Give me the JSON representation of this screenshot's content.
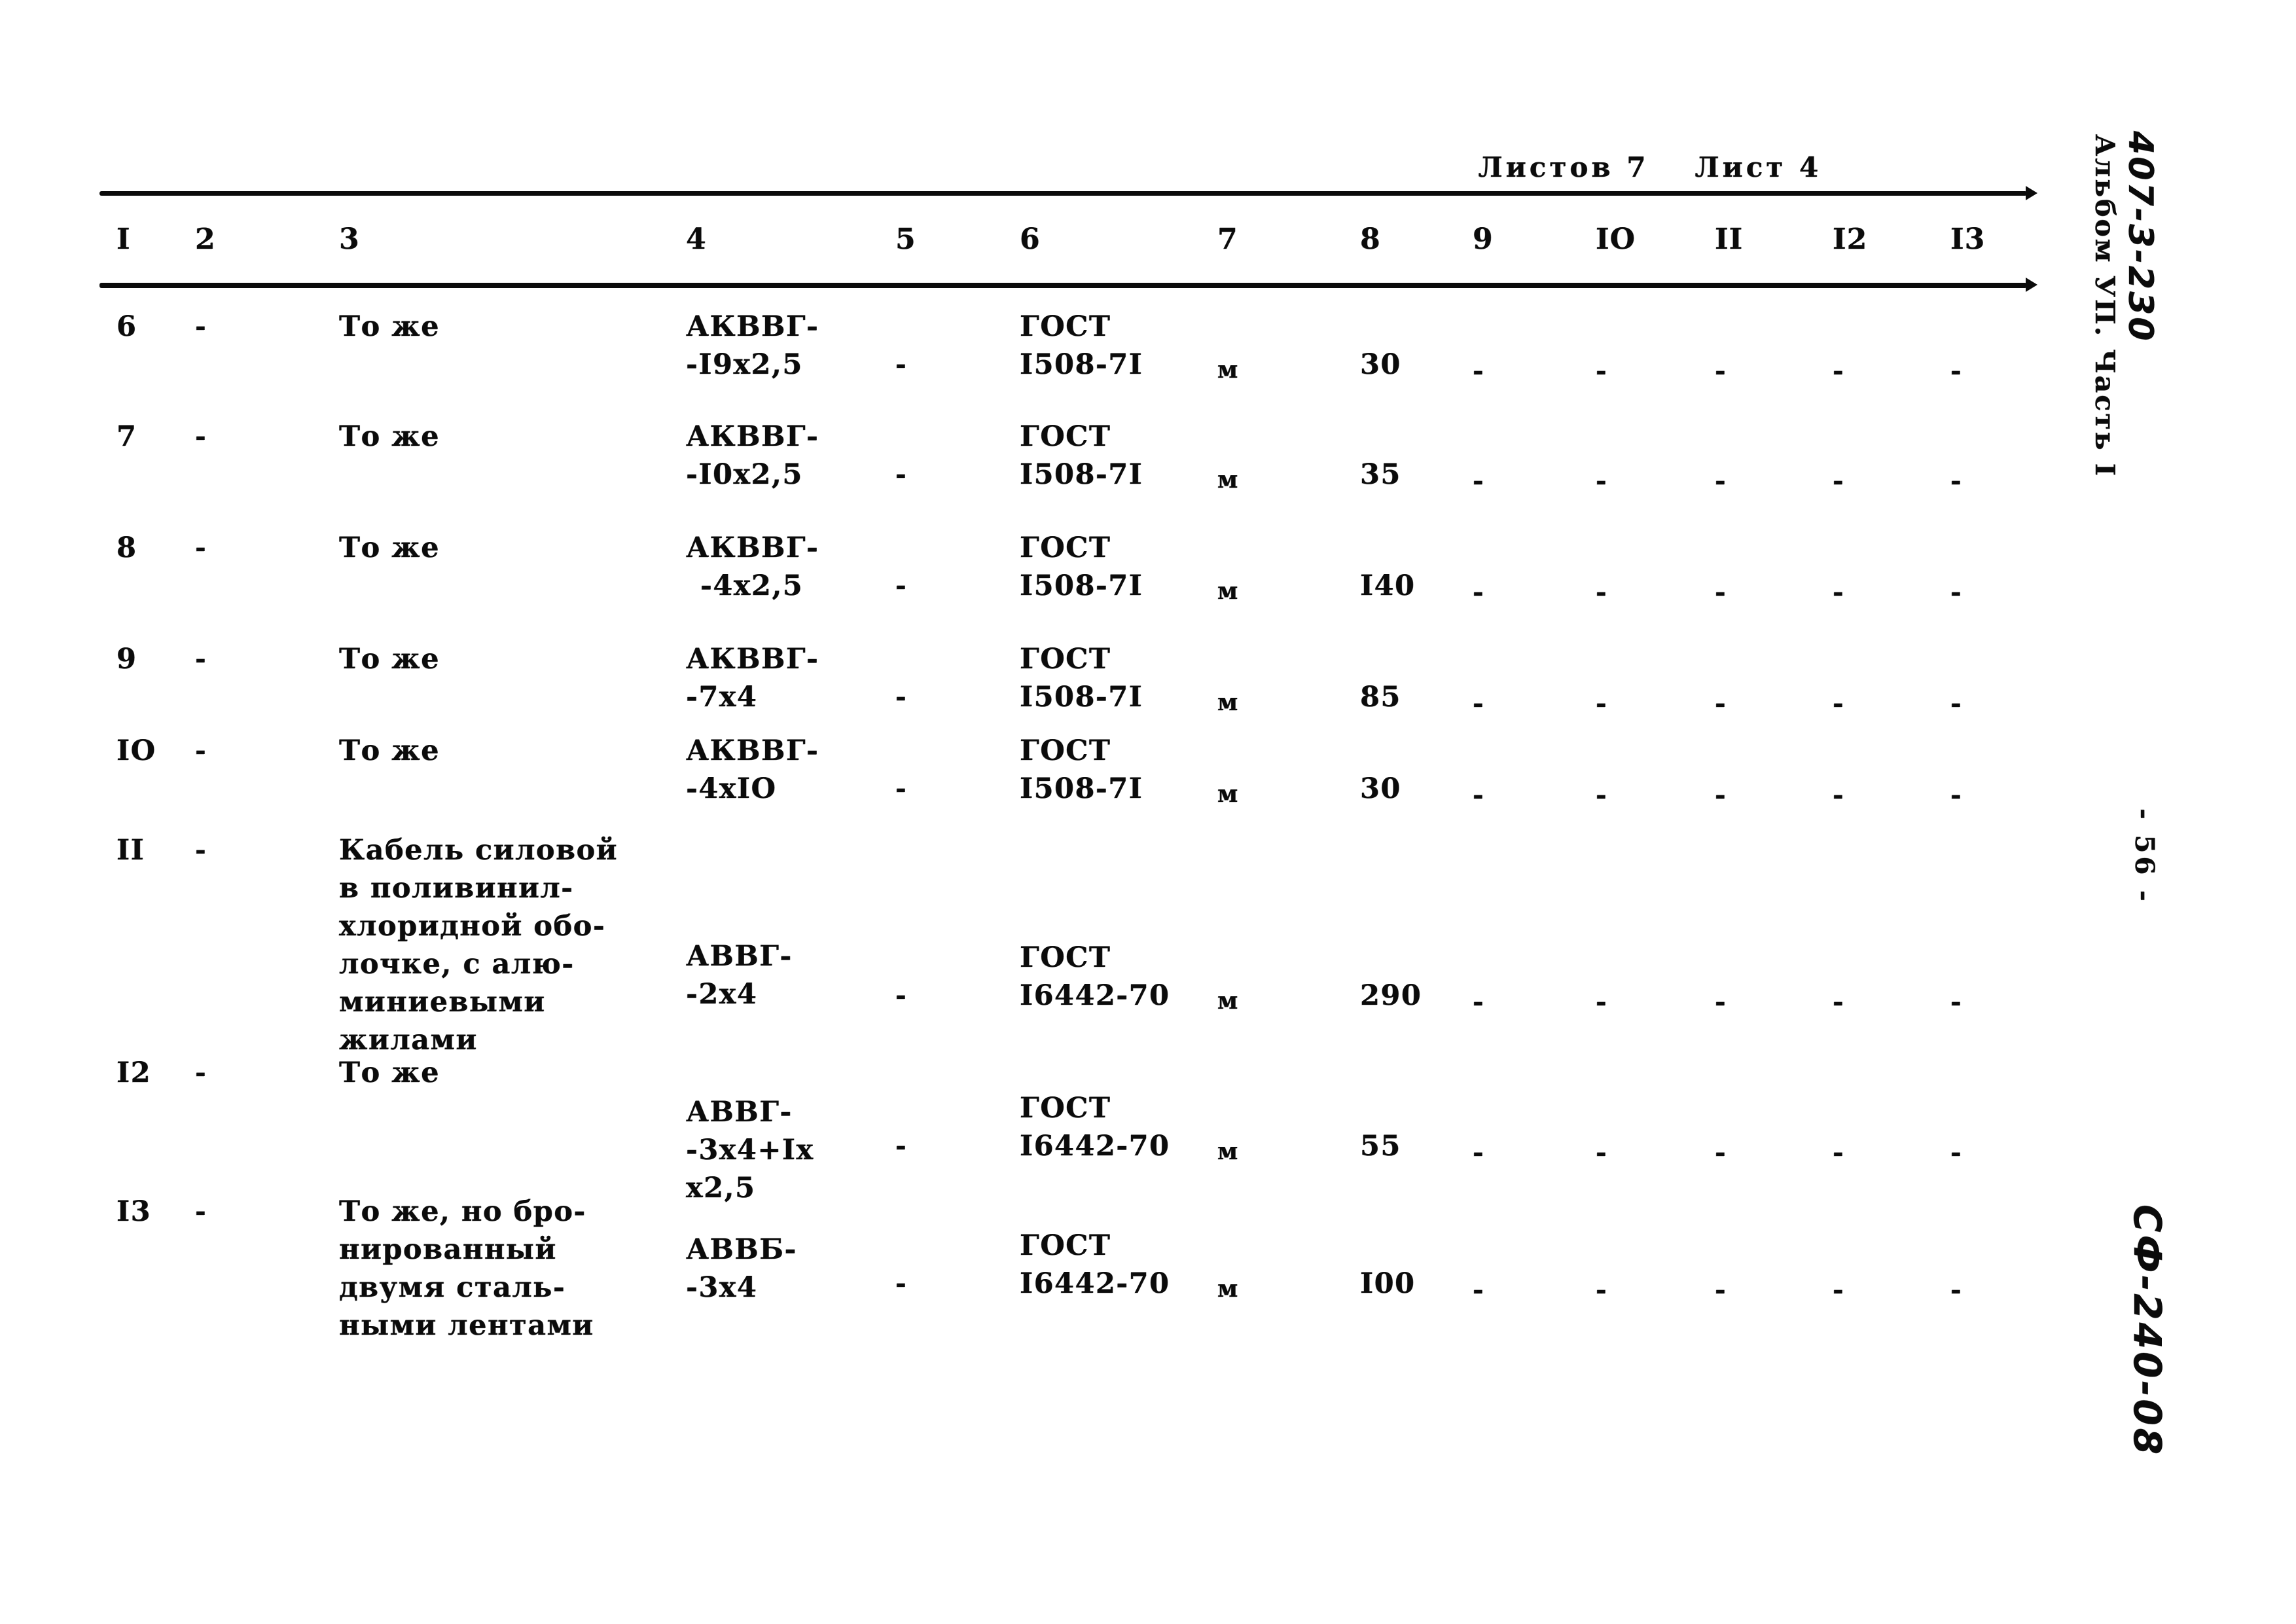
{
  "sheet": {
    "sheets_total_label": "Листов 7",
    "sheet_current_label": "Лист 4"
  },
  "margin": {
    "project_code": "407-3-230",
    "album_part": "Альбом УП. Часть I",
    "page_number": "- 56 -",
    "archive_code": "СФ-240-08"
  },
  "table": {
    "column_headers": [
      "I",
      "2",
      "3",
      "4",
      "5",
      "6",
      "7",
      "8",
      "9",
      "IO",
      "II",
      "I2",
      "I3"
    ],
    "rows": [
      {
        "c1": "6",
        "c2": "-",
        "c3": "То же",
        "c4_line1": "АКВВГ-",
        "c4_line2": "-I9x2,5",
        "c5": "-",
        "c6_line1": "ГОСТ",
        "c6_line2": "I508-7I",
        "c7": "м",
        "c8": "30",
        "c9": "-",
        "c10": "-",
        "c11": "-",
        "c12": "-",
        "c13": "-"
      },
      {
        "c1": "7",
        "c2": "-",
        "c3": "То же",
        "c4_line1": "АКВВГ-",
        "c4_line2": "-I0x2,5",
        "c5": "-",
        "c6_line1": "ГОСТ",
        "c6_line2": "I508-7I",
        "c7": "м",
        "c8": "35",
        "c9": "-",
        "c10": "-",
        "c11": "-",
        "c12": "-",
        "c13": "-"
      },
      {
        "c1": "8",
        "c2": "-",
        "c3": "То же",
        "c4_line1": "АКВВГ-",
        "c4_line2": "-4x2,5",
        "c5": "-",
        "c6_line1": "ГОСТ",
        "c6_line2": "I508-7I",
        "c7": "м",
        "c8": "I40",
        "c9": "-",
        "c10": "-",
        "c11": "-",
        "c12": "-",
        "c13": "-"
      },
      {
        "c1": "9",
        "c2": "-",
        "c3": "То же",
        "c4_line1": "АКВВГ-",
        "c4_line2": "-7x4",
        "c5": "-",
        "c6_line1": "ГОСТ",
        "c6_line2": "I508-7I",
        "c7": "м",
        "c8": "85",
        "c9": "-",
        "c10": "-",
        "c11": "-",
        "c12": "-",
        "c13": "-"
      },
      {
        "c1": "IO",
        "c2": "-",
        "c3": "То же",
        "c4_line1": "АКВВГ-",
        "c4_line2": "-4xIO",
        "c5": "-",
        "c6_line1": "ГОСТ",
        "c6_line2": "I508-7I",
        "c7": "м",
        "c8": "30",
        "c9": "-",
        "c10": "-",
        "c11": "-",
        "c12": "-",
        "c13": "-"
      },
      {
        "c1": "II",
        "c2": "-",
        "c3": "Кабель силовой\nв поливинил-\nхлоридной обо-\nлочке, с алю-\nминиевыми\nжилами",
        "c4_line1": "АВВГ-",
        "c4_line2": "-2x4",
        "c5": "-",
        "c6_line1": "ГОСТ",
        "c6_line2": "I6442-70",
        "c7": "м",
        "c8": "290",
        "c9": "-",
        "c10": "-",
        "c11": "-",
        "c12": "-",
        "c13": "-"
      },
      {
        "c1": "I2",
        "c2": "-",
        "c3": "То же",
        "c4_line1": "АВВГ-",
        "c4_line2": "-3x4+Ix",
        "c4_line3": "x2,5",
        "c5": "-",
        "c6_line1": "ГОСТ",
        "c6_line2": "I6442-70",
        "c7": "м",
        "c8": "55",
        "c9": "-",
        "c10": "-",
        "c11": "-",
        "c12": "-",
        "c13": "-"
      },
      {
        "c1": "I3",
        "c2": "-",
        "c3": "То же, но бро-\nнированный\nдвумя сталь-\nными лентами",
        "c4_line1": "АВВБ-",
        "c4_line2": "-3x4",
        "c5": "-",
        "c6_line1": "ГОСТ",
        "c6_line2": "I6442-70",
        "c7": "м",
        "c8": "I00",
        "c9": "-",
        "c10": "-",
        "c11": "-",
        "c12": "-",
        "c13": "-"
      }
    ]
  }
}
